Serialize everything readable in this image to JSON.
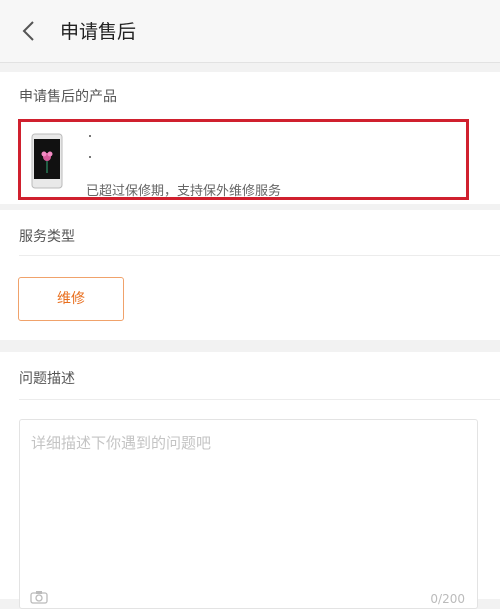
{
  "header": {
    "title": "申请售后"
  },
  "product_section": {
    "label": "申请售后的产品",
    "line1": "·",
    "line2": "·",
    "note": "已超过保修期，支持保外维修服务"
  },
  "service_section": {
    "label": "服务类型",
    "selected_type": "维修"
  },
  "description_section": {
    "label": "问题描述",
    "placeholder": "详细描述下你遇到的问题吧",
    "counter": "0/200"
  },
  "colors": {
    "highlight_border": "#d0202e",
    "accent": "#e86e1d"
  }
}
